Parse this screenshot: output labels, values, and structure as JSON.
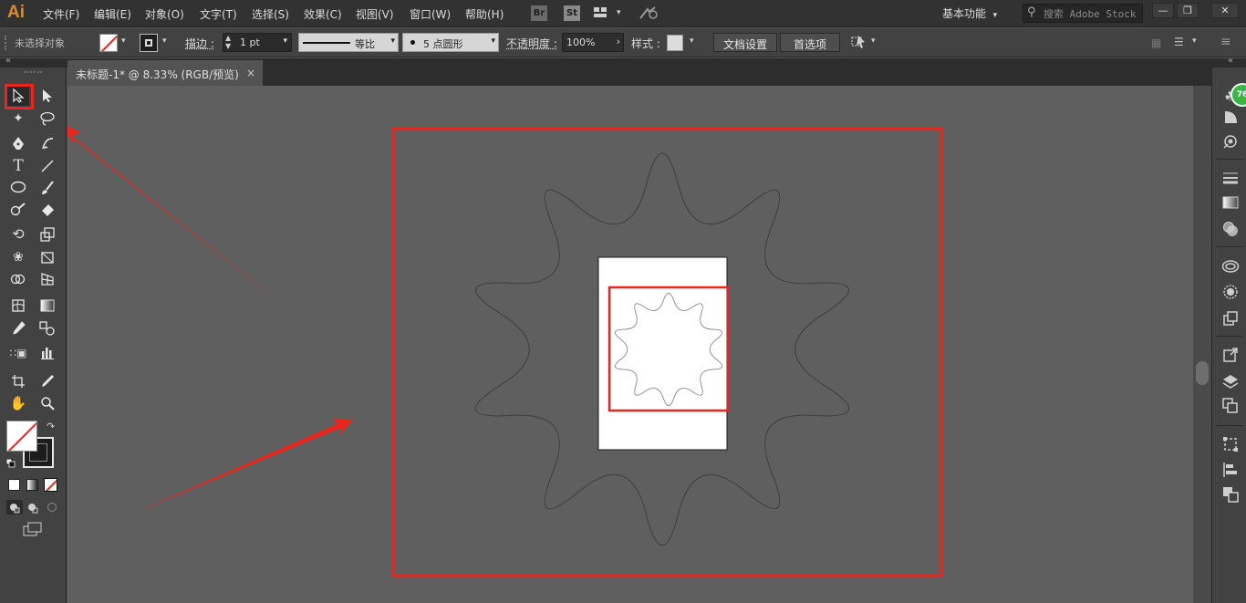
{
  "app": {
    "logo": "Ai",
    "menu": [
      "文件(F)",
      "编辑(E)",
      "对象(O)",
      "文字(T)",
      "选择(S)",
      "效果(C)",
      "视图(V)",
      "窗口(W)",
      "帮助(H)"
    ],
    "bridge_badge": "Br",
    "stock_badge": "St",
    "workspace": "基本功能",
    "search_placeholder": "搜索 Adobe Stock",
    "window_buttons": [
      "—",
      "❐",
      "✕"
    ]
  },
  "control_bar": {
    "selection_status": "未选择对象",
    "stroke_label": "描边",
    "stroke_weight": "1 pt",
    "stroke_profile": "等比",
    "brush": "5 点圆形",
    "opacity_label": "不透明度",
    "opacity_value": "100%",
    "style_label": "样式",
    "doc_setup": "文档设置",
    "preferences": "首选项"
  },
  "document": {
    "tab_title": "未标题-1* @ 8.33% (RGB/预览)",
    "close": "×"
  },
  "cc_badge": "76",
  "colors": {
    "highlight": "#e8261e",
    "artboard": "#ffffff",
    "canvas": "#5f5f5f",
    "star_stroke": "#3e3e3e"
  },
  "tools": [
    "selection-tool",
    "direct-selection-tool",
    "magic-wand-tool",
    "lasso-tool",
    "pen-tool",
    "curvature-tool",
    "type-tool",
    "line-segment-tool",
    "ellipse-tool",
    "paintbrush-tool",
    "shaper-tool",
    "eraser-tool",
    "rotate-tool",
    "scale-tool",
    "warp-tool",
    "free-transform-tool",
    "shape-builder-tool",
    "perspective-grid-tool",
    "mesh-tool",
    "gradient-tool",
    "eyedropper-tool",
    "blend-tool",
    "symbol-sprayer-tool",
    "column-graph-tool",
    "artboard-tool",
    "slice-tool",
    "hand-tool",
    "zoom-tool"
  ]
}
